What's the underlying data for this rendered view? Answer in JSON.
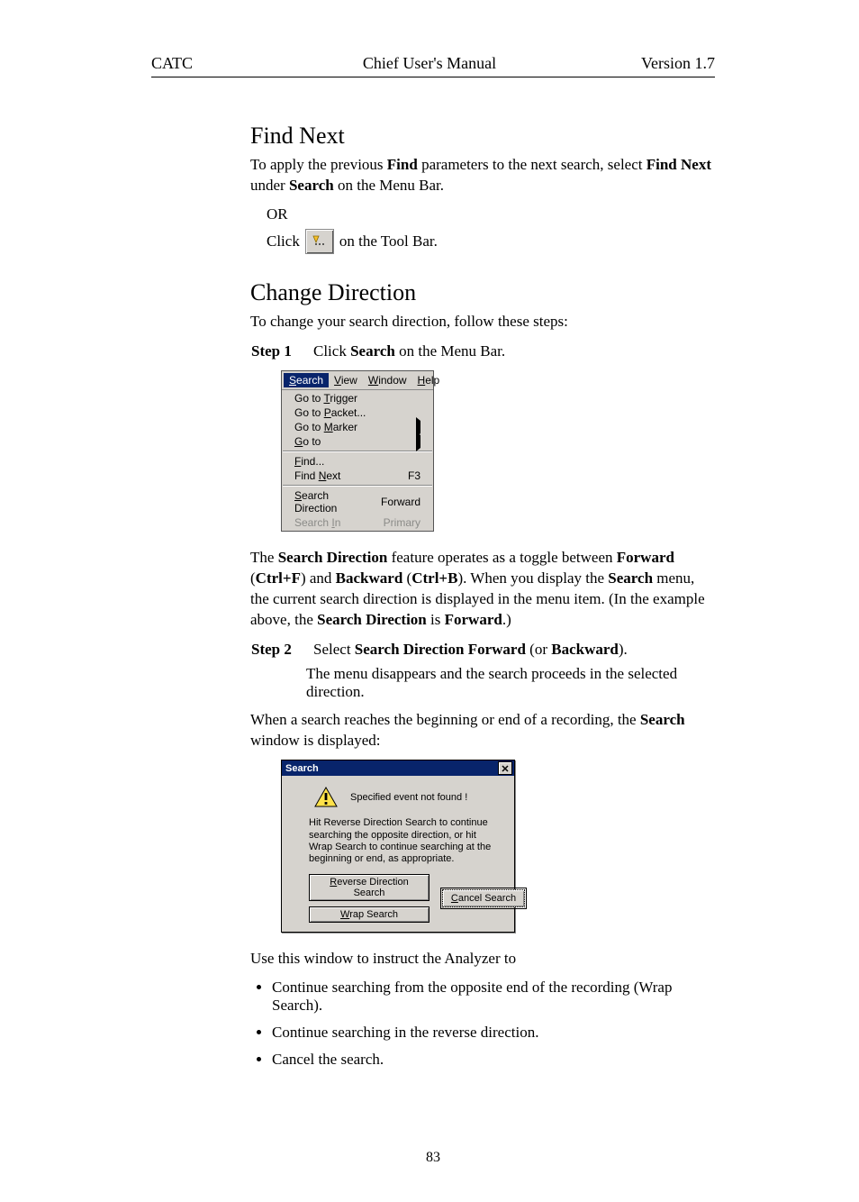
{
  "header": {
    "left": "CATC",
    "center": "Chief User's Manual",
    "right": "Version 1.7"
  },
  "section1": {
    "title": "Find Next",
    "intro_pre": "To apply the previous ",
    "intro_b1": "Find",
    "intro_mid": " parameters to the next search, select ",
    "intro_b2": "Find Next",
    "intro_post": " under ",
    "intro_b3": "Search",
    "intro_end": " on the Menu Bar.",
    "or": "OR",
    "click_pre": "Click ",
    "click_post": " on the Tool Bar."
  },
  "section2": {
    "title": "Change Direction",
    "intro": "To change your search direction, follow these steps:",
    "step1_label": "Step 1",
    "step1_a": "Click ",
    "step1_b": "Search",
    "step1_c": " on the Menu Bar.",
    "menu": {
      "bar": {
        "search": "Search",
        "view": "View",
        "window": "Window",
        "help": "Help"
      },
      "items": {
        "goto_trigger": "Go to Trigger",
        "goto_packet": "Go to Packet...",
        "goto_marker": "Go to Marker",
        "goto": "Go to",
        "find": "Find...",
        "find_next": "Find Next",
        "find_next_key": "F3",
        "search_dir": "Search Direction",
        "search_dir_val": "Forward",
        "search_in": "Search In",
        "search_in_val": "Primary"
      }
    },
    "para2_a": "The ",
    "para2_b": "Search Direction",
    "para2_c": " feature operates as a toggle between ",
    "para2_d": "Forward",
    "para2_e": " (",
    "para2_f": "Ctrl+F",
    "para2_g": ") and ",
    "para2_h": "Backward",
    "para2_i": " (",
    "para2_j": "Ctrl+B",
    "para2_k": "). When you display the ",
    "para2_l": "Search",
    "para2_m": " menu, the current search direction is displayed in the menu item. (In the example above, the ",
    "para2_n": "Search Direction",
    "para2_o": " is ",
    "para2_p": "Forward",
    "para2_q": ".)",
    "step2_label": "Step 2",
    "step2_a": "Select ",
    "step2_b": "Search Direction Forward",
    "step2_c": " (or ",
    "step2_d": "Backward",
    "step2_e": ").",
    "step2_result": "The menu disappears and the search proceeds in the selected direction.",
    "para3_a": "When a search reaches the beginning or end of a recording, the ",
    "para3_b": "Search",
    "para3_c": " window is displayed:",
    "dialog": {
      "title": "Search",
      "msg": "Specified event not found !",
      "instr": "Hit Reverse Direction Search to continue searching the opposite direction, or hit Wrap Search to continue searching at the beginning or end, as appropriate.",
      "btn_reverse": "Reverse Direction Search",
      "btn_wrap": "Wrap Search",
      "btn_cancel": "Cancel Search"
    },
    "para4": "Use this window to instruct the Analyzer to",
    "bullets": [
      "Continue searching from the opposite end of the recording (Wrap Search).",
      "Continue searching in the reverse direction.",
      "Cancel the search."
    ]
  },
  "page_number": "83"
}
